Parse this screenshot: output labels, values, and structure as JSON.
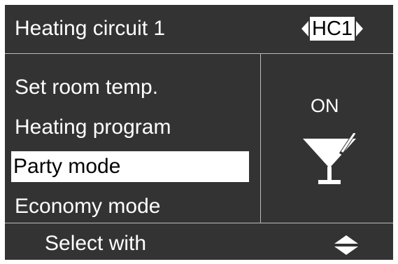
{
  "header": {
    "title": "Heating circuit 1",
    "circuit": "HC1"
  },
  "menu": {
    "items": [
      {
        "label": "Set room temp."
      },
      {
        "label": "Heating program"
      },
      {
        "label": "Party mode"
      },
      {
        "label": "Economy mode"
      }
    ],
    "selected": "Party mode"
  },
  "side_panel": {
    "status": "ON",
    "icon": "cocktail-glass-icon"
  },
  "footer": {
    "hint": "Select with",
    "icon": "up-down-arrows-icon"
  },
  "colors": {
    "background": "#333333",
    "foreground": "#ffffff",
    "divider": "#bcbcbc",
    "highlight": "#ffffff"
  }
}
